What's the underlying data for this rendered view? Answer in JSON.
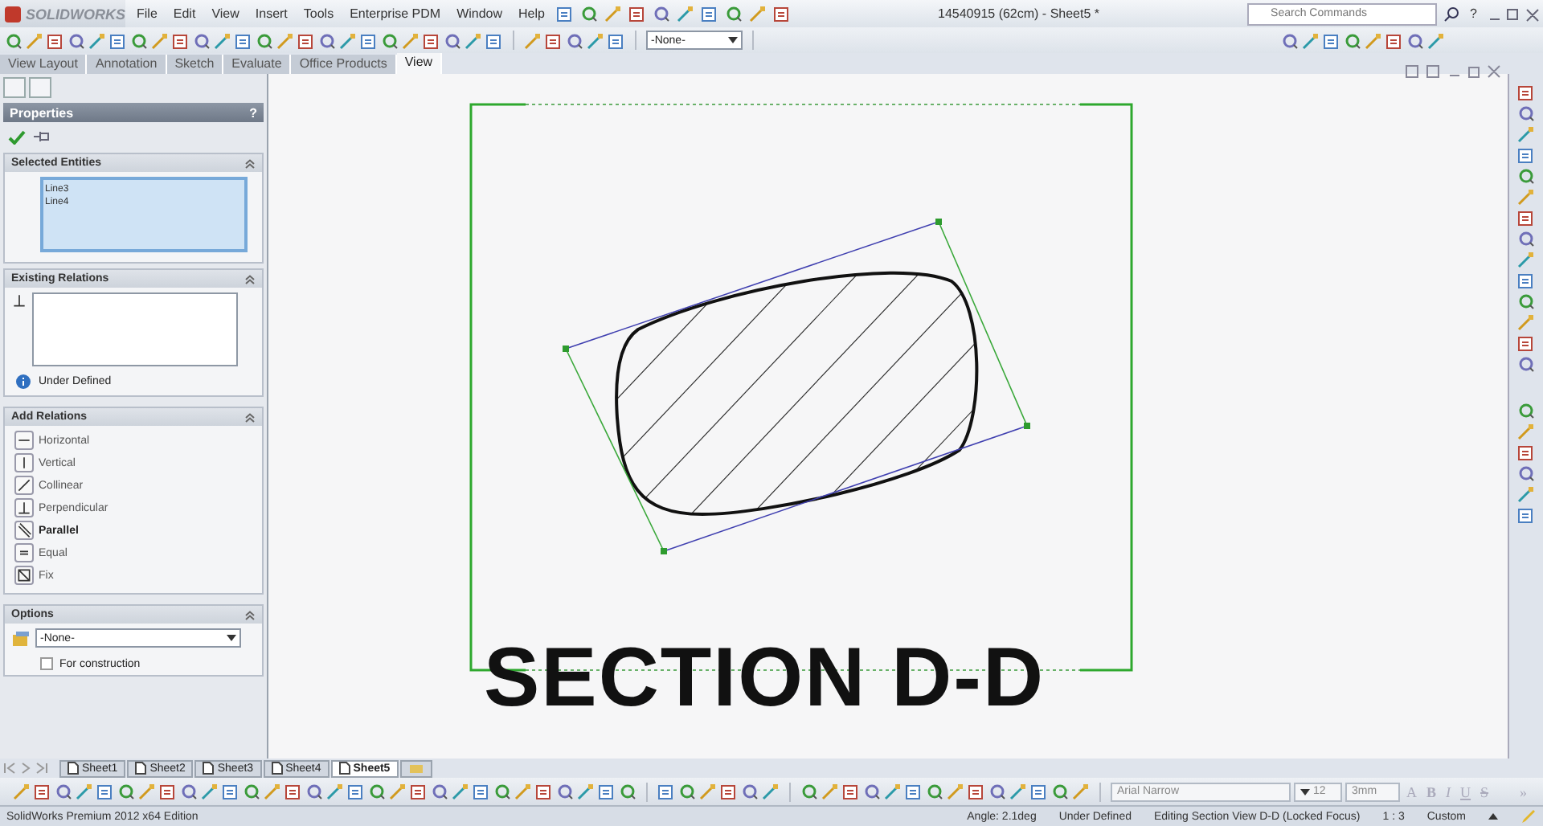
{
  "app": {
    "logo": "SOLIDWORKS",
    "menu": [
      "File",
      "Edit",
      "View",
      "Insert",
      "Tools",
      "Enterprise PDM",
      "Window",
      "Help"
    ],
    "document_title": "14540915 (62cm) - Sheet5 *",
    "search": {
      "placeholder": "Search Commands"
    },
    "help": "?"
  },
  "toolbar": {
    "layer": "-None-"
  },
  "command_tabs": [
    {
      "label": "View Layout",
      "selected": false
    },
    {
      "label": "Annotation",
      "selected": false
    },
    {
      "label": "Sketch",
      "selected": false
    },
    {
      "label": "Evaluate",
      "selected": false
    },
    {
      "label": "Office Products",
      "selected": false
    },
    {
      "label": "View",
      "selected": true
    }
  ],
  "panel": {
    "title": "Properties",
    "help": "?",
    "selected_entities": {
      "title": "Selected Entities",
      "items": [
        "Line3",
        "Line4"
      ]
    },
    "existing_relations": {
      "title": "Existing Relations",
      "status": "Under Defined"
    },
    "add_relations": {
      "title": "Add Relations",
      "items": [
        {
          "label": "Horizontal",
          "kind": "horizontal",
          "emphasized": false
        },
        {
          "label": "Vertical",
          "kind": "vertical",
          "emphasized": false
        },
        {
          "label": "Collinear",
          "kind": "collinear",
          "emphasized": false
        },
        {
          "label": "Perpendicular",
          "kind": "perpendicular",
          "emphasized": false
        },
        {
          "label": "Parallel",
          "kind": "parallel",
          "emphasized": true
        },
        {
          "label": "Equal",
          "kind": "equal",
          "emphasized": false
        },
        {
          "label": "Fix",
          "kind": "fix",
          "emphasized": false
        }
      ]
    },
    "options": {
      "title": "Options",
      "layer": "-None-",
      "for_construction": {
        "label": "For construction",
        "checked": false
      }
    }
  },
  "drawing": {
    "label": "SECTION D-D"
  },
  "sheet_tabs": [
    {
      "label": "Sheet1",
      "selected": false
    },
    {
      "label": "Sheet2",
      "selected": false
    },
    {
      "label": "Sheet3",
      "selected": false
    },
    {
      "label": "Sheet4",
      "selected": false
    },
    {
      "label": "Sheet5",
      "selected": true
    }
  ],
  "format_bar": {
    "font": "Arial Narrow",
    "size": "12",
    "height": "3mm",
    "styles": [
      "A",
      "B",
      "I",
      "U",
      "S"
    ],
    "more": "»"
  },
  "status_bar": {
    "edition": "SolidWorks Premium 2012 x64 Edition",
    "angle": "Angle: 2.1deg",
    "state": "Under Defined",
    "mode": "Editing Section View D-D (Locked Focus)",
    "scale": "1 : 3",
    "units": "Custom"
  }
}
